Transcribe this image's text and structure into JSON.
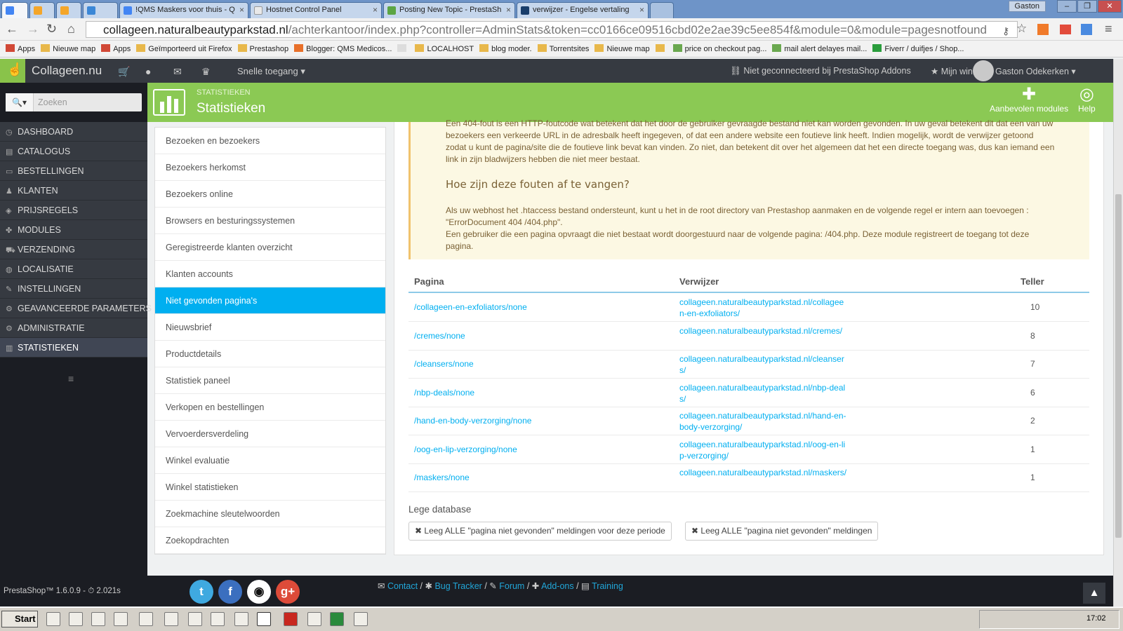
{
  "browser": {
    "tabs": [
      {
        "label": "",
        "color": "#4285f4"
      },
      {
        "label": "",
        "color": "#f4a62a"
      },
      {
        "label": "",
        "color": "#f4a62a"
      },
      {
        "label": "",
        "color": "#3b87d6"
      },
      {
        "label": "!QMS Maskers voor thuis - Q",
        "color": "#4285f4"
      },
      {
        "label": "Hostnet Control Panel",
        "color": "#e9e9e9"
      },
      {
        "label": "Posting New Topic - PrestaSh",
        "color": "#5ca544"
      },
      {
        "label": "verwijzer - Engelse vertaling",
        "color": "#193e6b"
      }
    ],
    "user_badge": "Gaston",
    "url_host": "collageen.naturalbeautyparkstad.nl",
    "url_path": "/achterkantoor/index.php?controller=AdminStats&token=cc0166ce09516cbd02e2ae39c5ee854f&module=0&module=pagesnotfound",
    "bookmarks": [
      "Apps",
      "Nieuwe map",
      "Apps",
      "Geïmporteerd uit Firefox",
      "Prestashop",
      "Blogger: QMS Medicos...",
      "",
      "LOCALHOST",
      "blog moder.",
      "Torrentsites",
      "Nieuwe map",
      "",
      "price on checkout pag...",
      "mail alert delayes mail...",
      "Fiverr / duifjes / Shop..."
    ]
  },
  "topnav": {
    "brand": "Collageen.nu",
    "quick_access": "Snelle toegang",
    "addons_status": "Niet geconnecteerd bij PrestaShop Addons",
    "my_shop": "Mijn winkel",
    "user_name": "Gaston Odekerken"
  },
  "sidebar": {
    "search_placeholder": "Zoeken",
    "items": [
      "DASHBOARD",
      "CATALOGUS",
      "BESTELLINGEN",
      "KLANTEN",
      "PRIJSREGELS",
      "MODULES",
      "VERZENDING",
      "LOCALISATIE",
      "INSTELLINGEN",
      "GEAVANCEERDE PARAMETERS",
      "ADMINISTRATIE",
      "STATISTIEKEN"
    ]
  },
  "toolbar": {
    "breadcrumb": "STATISTIEKEN",
    "title": "Statistieken",
    "recommended_modules": "Aanbevolen modules",
    "help": "Help"
  },
  "stats_nav": [
    "Bezoeken en bezoekers",
    "Bezoekers herkomst",
    "Bezoekers online",
    "Browsers en besturingssystemen",
    "Geregistreerde klanten overzicht",
    "Klanten accounts",
    "Niet gevonden pagina's",
    "Nieuwsbrief",
    "Productdetails",
    "Statistiek paneel",
    "Verkopen en bestellingen",
    "Vervoerdersverdeling",
    "Winkel evaluatie",
    "Winkel statistieken",
    "Zoekmachine sleutelwoorden",
    "Zoekopdrachten"
  ],
  "info": {
    "para1_line1": "Een 404-fout is een HTTP-foutcode wat betekent dat het door de gebruiker gevraagde bestand niet kan worden gevonden. In uw geval betekent dit dat een van uw",
    "para1_line2": "bezoekers een verkeerde URL in de adresbalk heeft ingegeven, of dat een andere website een foutieve link heeft. Indien mogelijk, wordt de verwijzer getoond",
    "para1_line3": "zodat u kunt de pagina/site die de foutieve link bevat kan vinden. Zo niet, dan betekent dit over het algemeen dat het een directe toegang was, dus kan iemand een",
    "para1_line4": "link in zijn bladwijzers hebben die niet meer bestaat.",
    "heading": "Hoe zijn deze fouten af te vangen?",
    "para2_line1": "Als uw webhost het .htaccess bestand ondersteunt, kunt u het in de root directory van Prestashop aanmaken en de volgende regel er intern aan toevoegen :",
    "para2_line2": "\"ErrorDocument 404 /404.php\".",
    "para3_line1": "Een gebruiker die een pagina opvraagt die niet bestaat wordt doorgestuurd naar de volgende pagina: /404.php. Deze module registreert de toegang tot deze",
    "para3_line2": "pagina."
  },
  "table": {
    "headers": {
      "page": "Pagina",
      "referrer": "Verwijzer",
      "counter": "Teller"
    },
    "rows": [
      {
        "page": "/collageen-en-exfoliators/none",
        "referrer": "collageen.naturalbeautyparkstad.nl/collageen-en-exfoliators/",
        "count": "10"
      },
      {
        "page": "/cremes/none",
        "referrer": "collageen.naturalbeautyparkstad.nl/cremes/",
        "count": "8"
      },
      {
        "page": "/cleansers/none",
        "referrer": "collageen.naturalbeautyparkstad.nl/cleansers/",
        "count": "7"
      },
      {
        "page": "/nbp-deals/none",
        "referrer": "collageen.naturalbeautyparkstad.nl/nbp-deals/",
        "count": "6"
      },
      {
        "page": "/hand-en-body-verzorging/none",
        "referrer": "collageen.naturalbeautyparkstad.nl/hand-en-body-verzorging/",
        "count": "2"
      },
      {
        "page": "/oog-en-lip-verzorging/none",
        "referrer": "collageen.naturalbeautyparkstad.nl/oog-en-lip-verzorging/",
        "count": "1"
      },
      {
        "page": "/maskers/none",
        "referrer": "collageen.naturalbeautyparkstad.nl/maskers/",
        "count": "1"
      }
    ]
  },
  "empty_db": {
    "title": "Lege database",
    "btn_period": "Leeg ALLE \"pagina niet gevonden\" meldingen voor deze periode",
    "btn_all": "Leeg ALLE \"pagina niet gevonden\" meldingen"
  },
  "footer": {
    "version": "PrestaShop™ 1.6.0.9 - ",
    "load_time": "2.021s",
    "links": [
      "Contact",
      "Bug Tracker",
      "Forum",
      "Add-ons",
      "Training"
    ]
  },
  "taskbar": {
    "start": "Start",
    "time": "17:02"
  },
  "colors": {
    "accent_green": "#8bc954",
    "active_blue": "#00aff0",
    "dark": "#363a41"
  }
}
